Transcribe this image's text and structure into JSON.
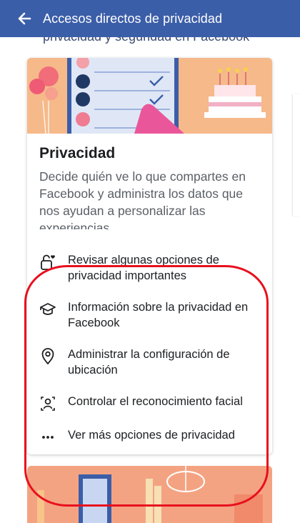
{
  "header": {
    "title": "Accesos directos de privacidad",
    "back_icon": "arrow-left-icon"
  },
  "partial_heading": "privacidad y seguridad en Facebook",
  "card": {
    "title": "Privacidad",
    "description": "Decide quién ve lo que compartes en Facebook y administra los datos que nos ayudan a personalizar las experiencias.",
    "items": [
      {
        "icon": "lock-heart-icon",
        "label": "Revisar algunas opciones de privacidad importantes"
      },
      {
        "icon": "graduation-cap-icon",
        "label": "Información sobre la privacidad en Facebook"
      },
      {
        "icon": "location-pin-icon",
        "label": "Administrar la configuración de ubicación"
      },
      {
        "icon": "face-scan-icon",
        "label": "Controlar el reconocimiento facial"
      },
      {
        "icon": "more-dots-icon",
        "label": "Ver más opciones de privacidad"
      }
    ]
  },
  "colors": {
    "header_bg": "#3b5ea8",
    "highlight_oval": "#e8101e",
    "hero_bg": "#f6b98a"
  }
}
